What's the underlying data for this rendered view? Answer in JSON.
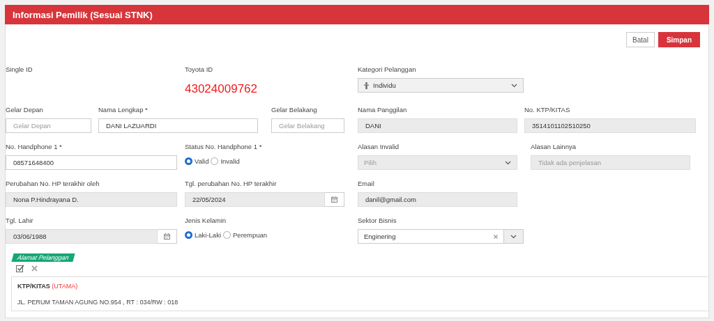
{
  "panel": {
    "title": "Informasi Pemilik (Sesuai STNK)"
  },
  "actions": [
    {
      "label": "Batal",
      "kind": "secondary"
    },
    {
      "label": "Simpan",
      "kind": "primary"
    }
  ],
  "rows": [
    {
      "fields": [
        {
          "kind": "empty",
          "label": "Single ID"
        },
        {
          "kind": "display",
          "label": "Toyota ID",
          "value": "43024009762"
        },
        {
          "kind": "category-select",
          "label": "Kategori Pelanggan",
          "value": "Individu"
        }
      ]
    },
    {
      "fields": [
        {
          "kind": "text",
          "label": "Gelar Depan",
          "placeholder": "Gelar Depan",
          "disabled": false
        },
        {
          "kind": "text",
          "label": "Nama Lengkap *",
          "value": "DANI LAZUARDI",
          "disabled": false
        },
        {
          "kind": "text",
          "label": "Gelar Belakang",
          "placeholder": "Gelar Belakang",
          "disabled": false
        },
        {
          "kind": "text",
          "label": "Nama Panggilan",
          "value": "DANI",
          "disabled": true
        },
        {
          "kind": "text",
          "label": "No. KTP/KITAS",
          "value": "3514101102510250",
          "disabled": true
        }
      ]
    },
    {
      "fields": [
        {
          "kind": "text",
          "label": "No. Handphone 1 *",
          "value": "08571648400",
          "disabled": false
        },
        {
          "kind": "radio",
          "label": "Status No. Handphone 1 *",
          "options": [
            {
              "label": "Valid",
              "selected": true
            },
            {
              "label": "Invalid",
              "selected": false
            }
          ]
        },
        {
          "kind": "select",
          "label": "Alasan Invalid",
          "placeholder": "Pilih",
          "disabled": true
        },
        {
          "kind": "text",
          "label": "Alasan Lainnya",
          "placeholder": "Tidak ada penjelasan",
          "disabled": true
        }
      ]
    },
    {
      "fields": [
        {
          "kind": "text",
          "label": "Perubahan No. HP terakhir oleh",
          "value": "Nona P.Hindrayana D.",
          "disabled": true
        },
        {
          "kind": "date",
          "label": "Tgl. perubahan No. HP terakhir",
          "value": "22/05/2024",
          "disabled": true
        },
        {
          "kind": "text",
          "label": "Email",
          "value": "danil@gmail.com",
          "disabled": true
        }
      ]
    },
    {
      "fields": [
        {
          "kind": "date",
          "label": "Tgl. Lahir",
          "value": "03/06/1988",
          "disabled": true
        },
        {
          "kind": "radio",
          "label": "Jenis Kelamin",
          "options": [
            {
              "label": "Laki-Laki",
              "selected": true
            },
            {
              "label": "Perempuan",
              "selected": false
            }
          ]
        },
        {
          "kind": "clearable-select",
          "label": "Sektor Bisnis",
          "value": "Enginering"
        }
      ]
    }
  ],
  "address_section": {
    "tag": "Alamat Pelanggan",
    "addresses": [
      {
        "type": "KTP/KITAS",
        "badge": "(UTAMA)",
        "line": "JL. PERUM TAMAN AGUNG NO.954 , RT : 034/RW : 018"
      }
    ]
  }
}
